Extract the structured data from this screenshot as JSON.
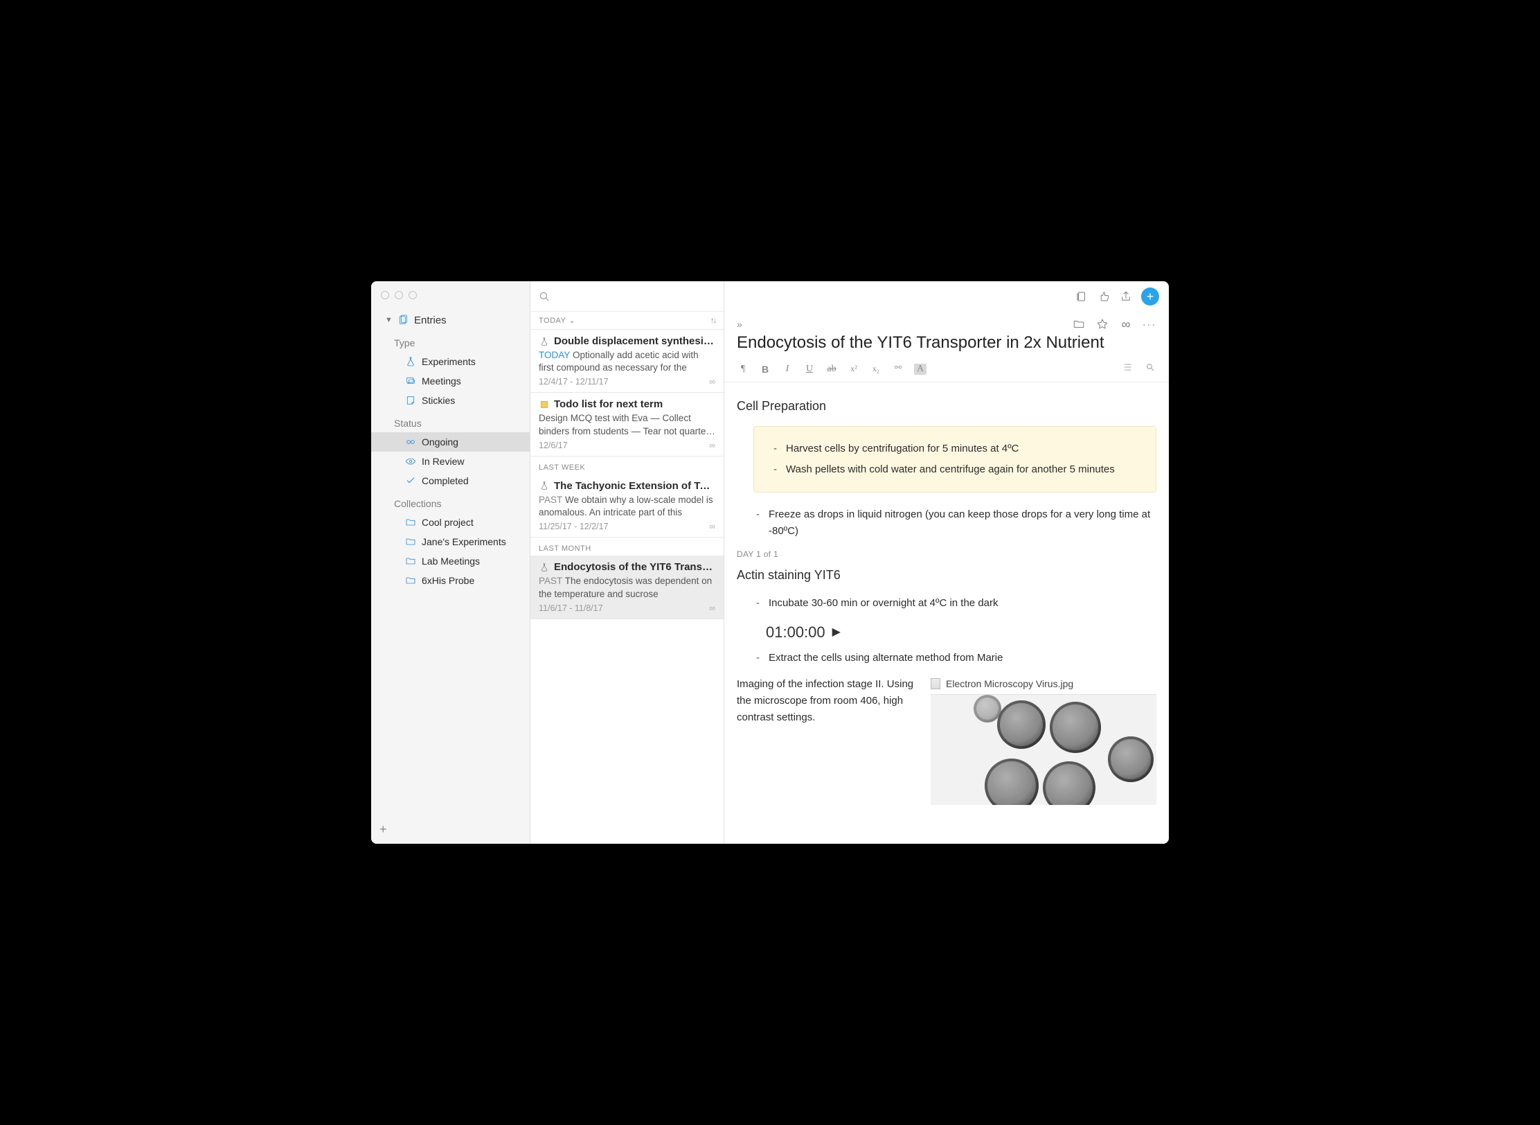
{
  "sidebar": {
    "entries_label": "Entries",
    "groups": {
      "type_label": "Type",
      "type_items": [
        {
          "label": "Experiments"
        },
        {
          "label": "Meetings"
        },
        {
          "label": "Stickies"
        }
      ],
      "status_label": "Status",
      "status_items": [
        {
          "label": "Ongoing"
        },
        {
          "label": "In Review"
        },
        {
          "label": "Completed"
        }
      ],
      "collections_label": "Collections",
      "collection_items": [
        {
          "label": "Cool project"
        },
        {
          "label": "Jane's Experiments"
        },
        {
          "label": "Lab Meetings"
        },
        {
          "label": "6xHis Probe"
        }
      ]
    }
  },
  "list": {
    "filter_label": "TODAY",
    "sections": {
      "today": "TODAY",
      "last_week": "LAST WEEK",
      "last_month": "LAST MONTH"
    },
    "items": [
      {
        "title": "Double displacement synthesi…",
        "status_tag": "TODAY",
        "preview": "Optionally add acetic acid with first compound as necessary for the synthesis",
        "dates": "12/4/17 - 12/11/17"
      },
      {
        "title": "Todo list for next term",
        "preview": "Design MCQ test with Eva — Collect binders from students — Tear not quarte…",
        "dates": "12/6/17"
      },
      {
        "title": "The Tachyonic Extension of To…",
        "status_tag": "PAST",
        "preview": "We obtain why a low-scale model is anomalous. An intricate part of this analy…",
        "dates": "11/25/17 - 12/2/17"
      },
      {
        "title": "Endocytosis of the YIT6 Trans…",
        "status_tag": "PAST",
        "preview": "The endocytosis was dependent on the temperature and sucrose concentrati…",
        "dates": "11/6/17 - 11/8/17"
      }
    ]
  },
  "entry": {
    "title": "Endocytosis of the YIT6 Transporter in 2x Nutrient",
    "section1": "Cell Preparation",
    "callout": [
      "Harvest cells by centrifugation for 5 minutes at 4ºC",
      "Wash pellets with cold water and centrifuge again for another 5 minutes"
    ],
    "bullet_after": "Freeze as drops in liquid nitrogen (you can keep those drops for a very long time at -80ºC)",
    "day_label": "DAY 1 of 1",
    "section2": "Actin staining YIT6",
    "steps": [
      "Incubate 30-60 min or overnight at 4ºC in the dark",
      "Extract the cells using alternate method from Marie"
    ],
    "timer": "01:00:00",
    "image_caption": "Imaging of the infection stage II. Using the microscope from room 406, high contrast settings.",
    "attachment_name": "Electron Microscopy Virus.jpg"
  }
}
